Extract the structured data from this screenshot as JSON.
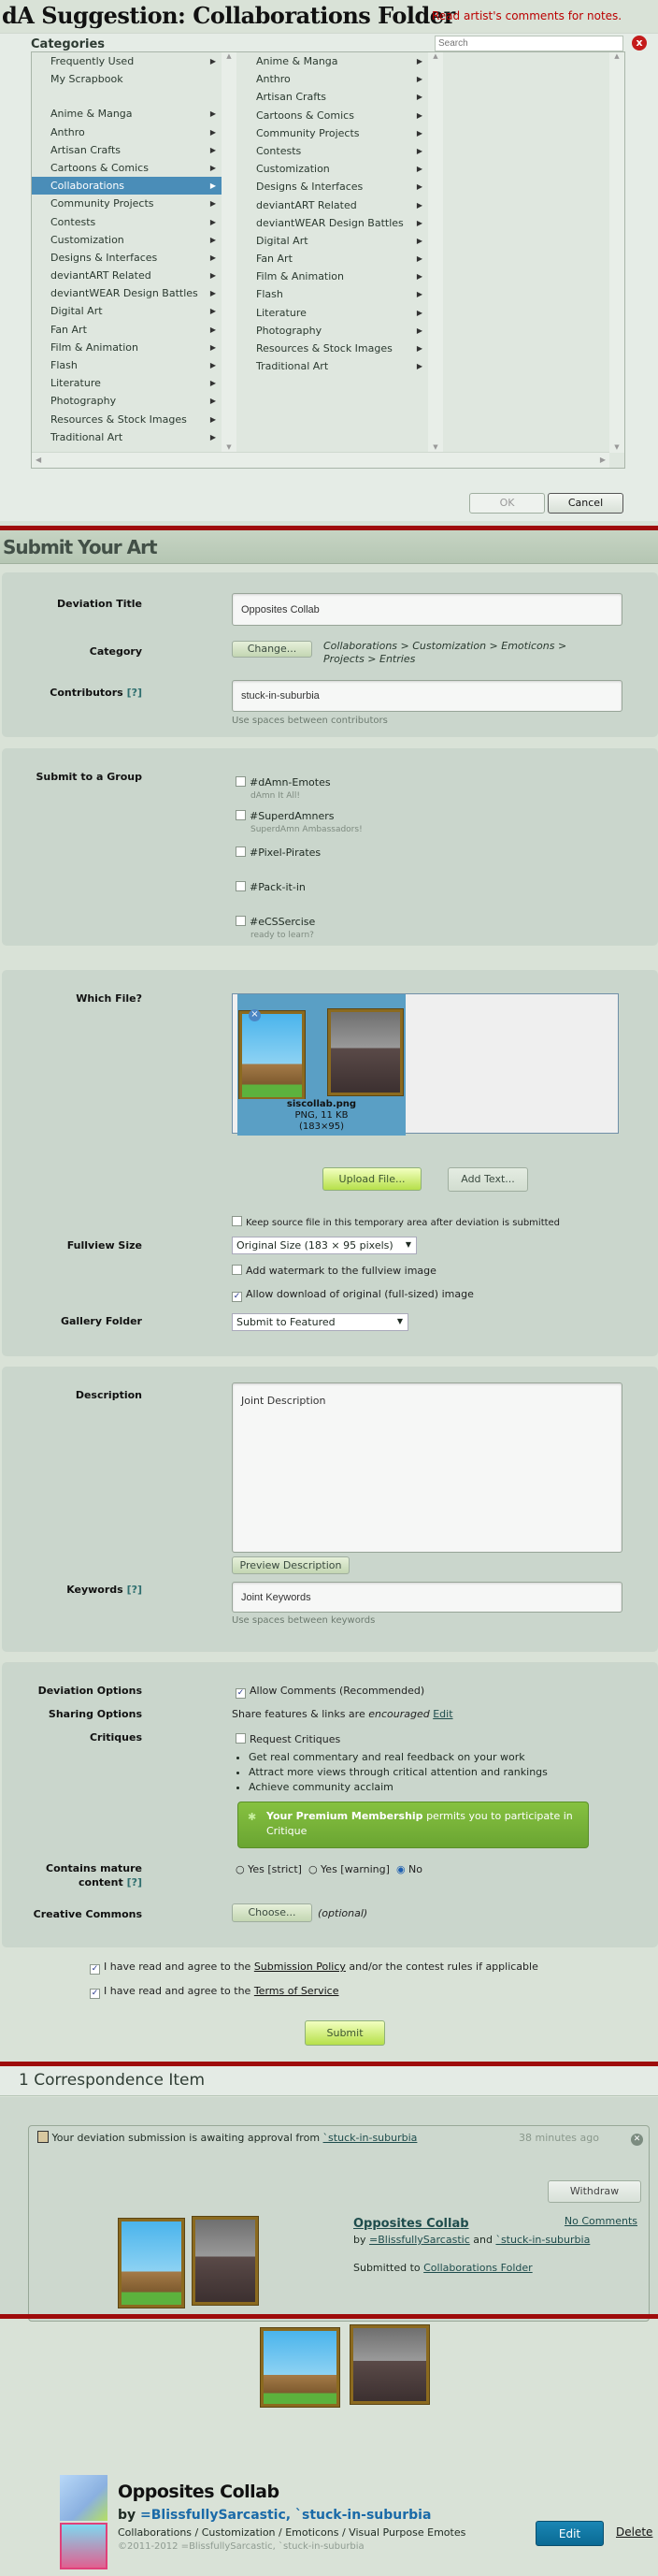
{
  "dialog": {
    "title": "dA Suggestion: Collaborations Folder",
    "note": "Read artist's comments for notes.",
    "categories_label": "Categories",
    "search_placeholder": "Search",
    "close": "x",
    "column1": [
      {
        "label": "Frequently Used",
        "arrow": true
      },
      {
        "label": "My Scrapbook",
        "arrow": false
      },
      {
        "gap": true
      },
      {
        "label": "Anime & Manga",
        "arrow": true
      },
      {
        "label": "Anthro",
        "arrow": true
      },
      {
        "label": "Artisan Crafts",
        "arrow": true
      },
      {
        "label": "Cartoons & Comics",
        "arrow": true
      },
      {
        "label": "Collaborations",
        "arrow": true,
        "selected": true
      },
      {
        "label": "Community Projects",
        "arrow": true
      },
      {
        "label": "Contests",
        "arrow": true
      },
      {
        "label": "Customization",
        "arrow": true
      },
      {
        "label": "Designs & Interfaces",
        "arrow": true
      },
      {
        "label": "deviantART Related",
        "arrow": true
      },
      {
        "label": "deviantWEAR Design Battles",
        "arrow": true
      },
      {
        "label": "Digital Art",
        "arrow": true
      },
      {
        "label": "Fan Art",
        "arrow": true
      },
      {
        "label": "Film & Animation",
        "arrow": true
      },
      {
        "label": "Flash",
        "arrow": true
      },
      {
        "label": "Literature",
        "arrow": true
      },
      {
        "label": "Photography",
        "arrow": true
      },
      {
        "label": "Resources & Stock Images",
        "arrow": true
      },
      {
        "label": "Traditional Art",
        "arrow": true
      }
    ],
    "column2": [
      {
        "label": "Anime & Manga",
        "arrow": true
      },
      {
        "label": "Anthro",
        "arrow": true
      },
      {
        "label": "Artisan Crafts",
        "arrow": true
      },
      {
        "label": "Cartoons & Comics",
        "arrow": true
      },
      {
        "label": "Community Projects",
        "arrow": true
      },
      {
        "label": "Contests",
        "arrow": true
      },
      {
        "label": "Customization",
        "arrow": true
      },
      {
        "label": "Designs & Interfaces",
        "arrow": true
      },
      {
        "label": "deviantART Related",
        "arrow": true
      },
      {
        "label": "deviantWEAR Design Battles",
        "arrow": true
      },
      {
        "label": "Digital Art",
        "arrow": true
      },
      {
        "label": "Fan Art",
        "arrow": true
      },
      {
        "label": "Film & Animation",
        "arrow": true
      },
      {
        "label": "Flash",
        "arrow": true
      },
      {
        "label": "Literature",
        "arrow": true
      },
      {
        "label": "Photography",
        "arrow": true
      },
      {
        "label": "Resources & Stock Images",
        "arrow": true
      },
      {
        "label": "Traditional Art",
        "arrow": true
      }
    ],
    "ok": "OK",
    "cancel": "Cancel"
  },
  "submit": {
    "header": "Submit Your Art",
    "title_label": "Deviation Title",
    "title_value": "Opposites Collab",
    "category_label": "Category",
    "change_button": "Change...",
    "category_path": "Collaborations > Customization > Emoticons > Projects > Entries",
    "contributors_label": "Contributors",
    "help": "[?]",
    "contributors_value": "stuck-in-suburbia",
    "contributors_hint": "Use spaces between contributors",
    "group_label": "Submit to a Group",
    "groups": [
      {
        "name": "#dAmn-Emotes",
        "tagline": "dAmn It All!",
        "checked": false
      },
      {
        "name": "#SuperdAmners",
        "tagline": "SuperdAmn Ambassadors!",
        "checked": false
      },
      {
        "name": "#Pixel-Pirates",
        "tagline": "",
        "checked": false
      },
      {
        "name": "#Pack-it-in",
        "tagline": "",
        "checked": false
      },
      {
        "name": "#eCSSercise",
        "tagline": "ready to learn?",
        "checked": false
      }
    ],
    "file_label": "Which File?",
    "file": {
      "name": "siscollab.png",
      "type": "PNG, 11 KB",
      "dims": "(183×95)"
    },
    "upload_button": "Upload File...",
    "add_text_button": "Add Text...",
    "keep_source": "Keep source file in this temporary area after deviation is submitted",
    "fullview_label": "Fullview Size",
    "fullview_value": "Original Size (183 × 95 pixels)",
    "watermark": "Add watermark to the fullview image",
    "allow_download": "Allow download of original (full-sized) image",
    "gallery_label": "Gallery Folder",
    "gallery_value": "Submit to Featured",
    "description_label": "Description",
    "description_value": "Joint Description",
    "preview_button": "Preview Description",
    "keywords_label": "Keywords",
    "keywords_value": "Joint Keywords",
    "keywords_hint": "Use spaces between keywords",
    "deviation_options_label": "Deviation Options",
    "allow_comments": "Allow Comments (Recommended)",
    "sharing_label": "Sharing Options",
    "sharing_text": "Share features & links are",
    "sharing_em": "encouraged",
    "sharing_edit": "Edit",
    "critiques_label": "Critiques",
    "request_critiques": "Request Critiques",
    "critique_bullets": [
      "Get real commentary and real feedback on your work",
      "Attract more views through critical attention and rankings",
      "Achieve community acclaim"
    ],
    "premium_bold": "Your Premium Membership",
    "premium_rest": "permits you to participate in Critique",
    "mature_label_1": "Contains mature",
    "mature_label_2": "content",
    "mature_options": [
      "Yes [strict]",
      "Yes [warning]",
      "No"
    ],
    "mature_selected": "No",
    "cc_label": "Creative Commons",
    "choose_button": "Choose...",
    "optional": "(optional)",
    "agree1_pre": "I have read and agree to the",
    "agree1_link": "Submission Policy",
    "agree1_post": "and/or the contest rules if applicable",
    "agree2_pre": "I have read and agree to the",
    "agree2_link": "Terms of Service",
    "submit_button": "Submit"
  },
  "correspondence": {
    "header": "1 Correspondence Item",
    "message": "Your deviation submission is awaiting approval from",
    "from_user": "`stuck-in-suburbia",
    "time": "38 minutes ago",
    "withdraw": "Withdraw",
    "title": "Opposites Collab",
    "no_comments": "No Comments",
    "by": "by",
    "author1": "=BlissfullySarcastic",
    "and": "and",
    "author2": "`stuck-in-suburbia",
    "submitted_to": "Submitted to",
    "folder": "Collaborations Folder"
  },
  "deviation": {
    "title": "Opposites Collab",
    "by": "by",
    "author1": "=BlissfullySarcastic,",
    "author2": "`stuck-in-suburbia",
    "path": "Collaborations / Customization / Emoticons / Visual Purpose Emotes",
    "copyright": "©2011-2012 =BlissfullySarcastic, `stuck-in-suburbia",
    "edit": "Edit",
    "delete": "Delete"
  },
  "colors": {
    "accent_red": "#9e0b0b",
    "selected_blue": "#4a8db8",
    "premium_green": "#7ab83a",
    "edit_blue": "#0a6a94"
  }
}
